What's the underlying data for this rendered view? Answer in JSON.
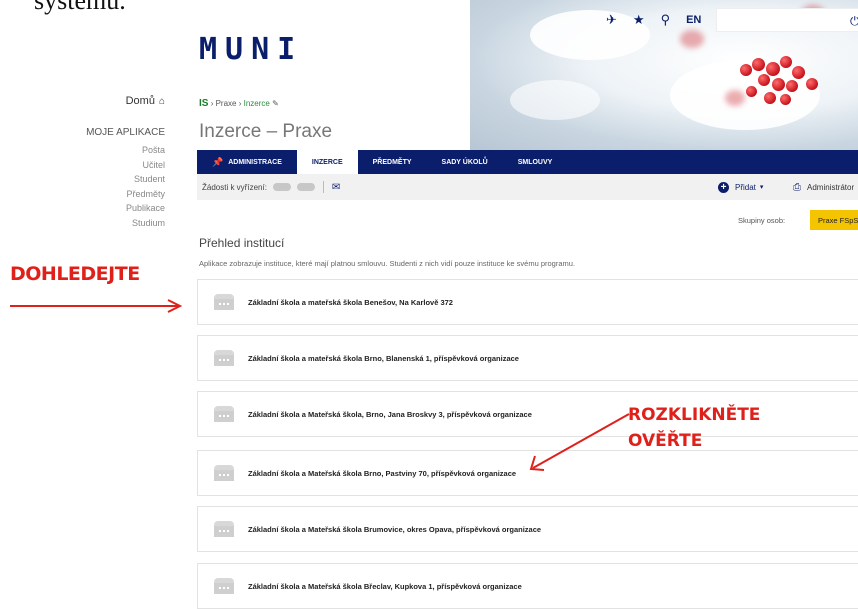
{
  "caption": "systému.",
  "top": {
    "lang": "EN"
  },
  "logo": "MUNI",
  "sidebar": {
    "home": "Domů",
    "section": "MOJE APLIKACE",
    "items": [
      "Pošta",
      "Učitel",
      "Student",
      "Předměty",
      "Publikace",
      "Studium"
    ]
  },
  "breadcrumb": {
    "logo": "IS",
    "items": [
      "Praxe",
      "Inzerce"
    ]
  },
  "page_title": "Inzerce – Praxe",
  "nav": {
    "tabs": [
      {
        "label": "ADMINISTRACE"
      },
      {
        "label": "INZERCE"
      },
      {
        "label": "PŘEDMĚTY"
      },
      {
        "label": "SADY ÚKOLŮ"
      },
      {
        "label": "SMLOUVY"
      }
    ]
  },
  "subbar": {
    "requests_label": "Žádosti k vyřízení:",
    "add_label": "Přidat",
    "admin_label": "Administrátor"
  },
  "groups": {
    "label": "Skupiny osob:",
    "button": "Praxe FSpS"
  },
  "section": {
    "title": "Přehled institucí",
    "info": "Aplikace zobrazuje instituce, které mají platnou smlouvu. Studenti z nich vidí pouze instituce ke svému programu."
  },
  "institutions": [
    "Základní škola a mateřská škola Benešov, Na Karlově 372",
    "Základní škola a mateřská škola Brno, Blanenská 1, příspěvková organizace",
    "Základní škola a Mateřská škola, Brno, Jana Broskvy 3, příspěvková organizace",
    "Základní škola a Mateřská škola Brno, Pastviny 70, příspěvková organizace",
    "Základní škola a Mateřská škola Brumovice, okres Opava, příspěvková organizace",
    "Základní škola a Mateřská škola Břeclav, Kupkova 1, příspěvková organizace"
  ],
  "annotations": {
    "find": "DOHLEDEJTE",
    "expand": "ROZKLIKNĚTE",
    "verify": "OVĚŘTE"
  },
  "colors": {
    "brand": "#0b1e6b",
    "accent_yellow": "#f5c400",
    "annotation_red": "#e0211b"
  }
}
